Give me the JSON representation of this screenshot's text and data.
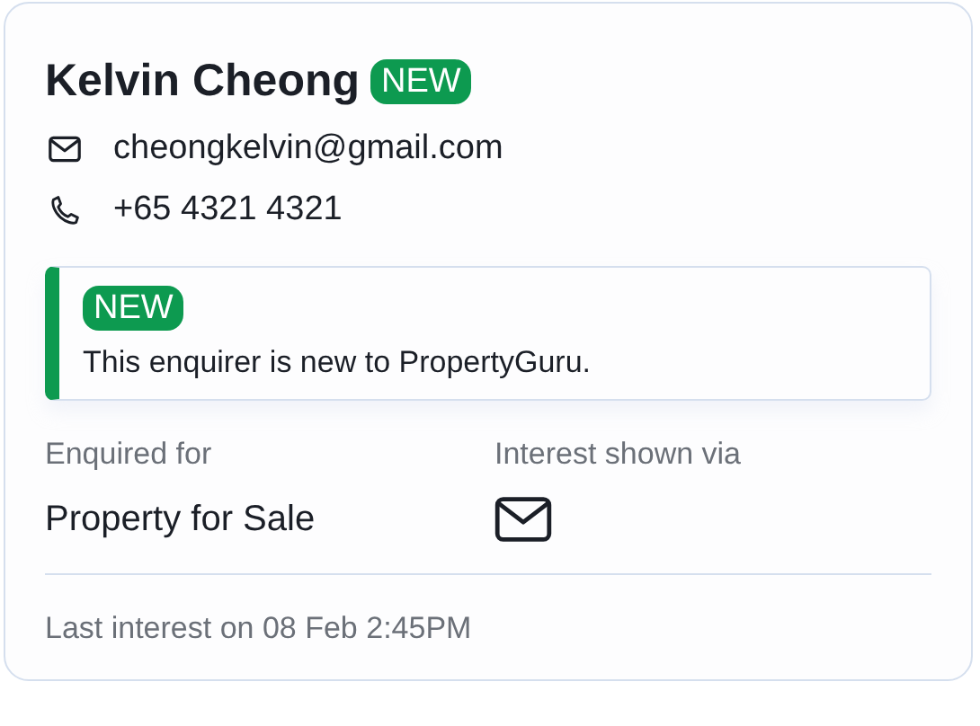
{
  "contact": {
    "name": "Kelvin Cheong",
    "badge": "NEW",
    "details": [
      {
        "kind": "email",
        "text": "cheongkelvin@gmail.com"
      },
      {
        "kind": "phone",
        "text": "+65 4321 4321"
      }
    ]
  },
  "notice": {
    "badge": "NEW",
    "message": "This enquirer is new to PropertyGuru."
  },
  "enquiry": {
    "label": "Enquired for",
    "value": "Property for Sale"
  },
  "interest": {
    "label": "Interest shown via",
    "channel": {
      "kind": "email"
    }
  },
  "footer": "Last interest on 08 Feb 2:45PM"
}
